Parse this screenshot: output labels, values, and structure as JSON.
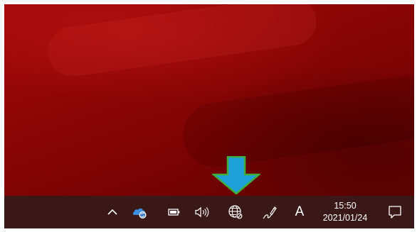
{
  "taskbar": {
    "tray_icons": [
      {
        "name": "show-hidden-icons-icon"
      },
      {
        "name": "onedrive-sync-icon"
      },
      {
        "name": "battery-icon"
      },
      {
        "name": "volume-icon"
      },
      {
        "name": "network-globe-icon"
      },
      {
        "name": "pen-ink-icon"
      }
    ],
    "input_language": "A",
    "clock": {
      "time": "15:50",
      "date": "2021/01/24"
    }
  },
  "annotation": {
    "arrow_color": "#1ea0d8",
    "arrow_outline": "#3fae3a"
  },
  "colors": {
    "taskbar_bg": "#3a1818",
    "desktop_red": "#8e0606"
  }
}
